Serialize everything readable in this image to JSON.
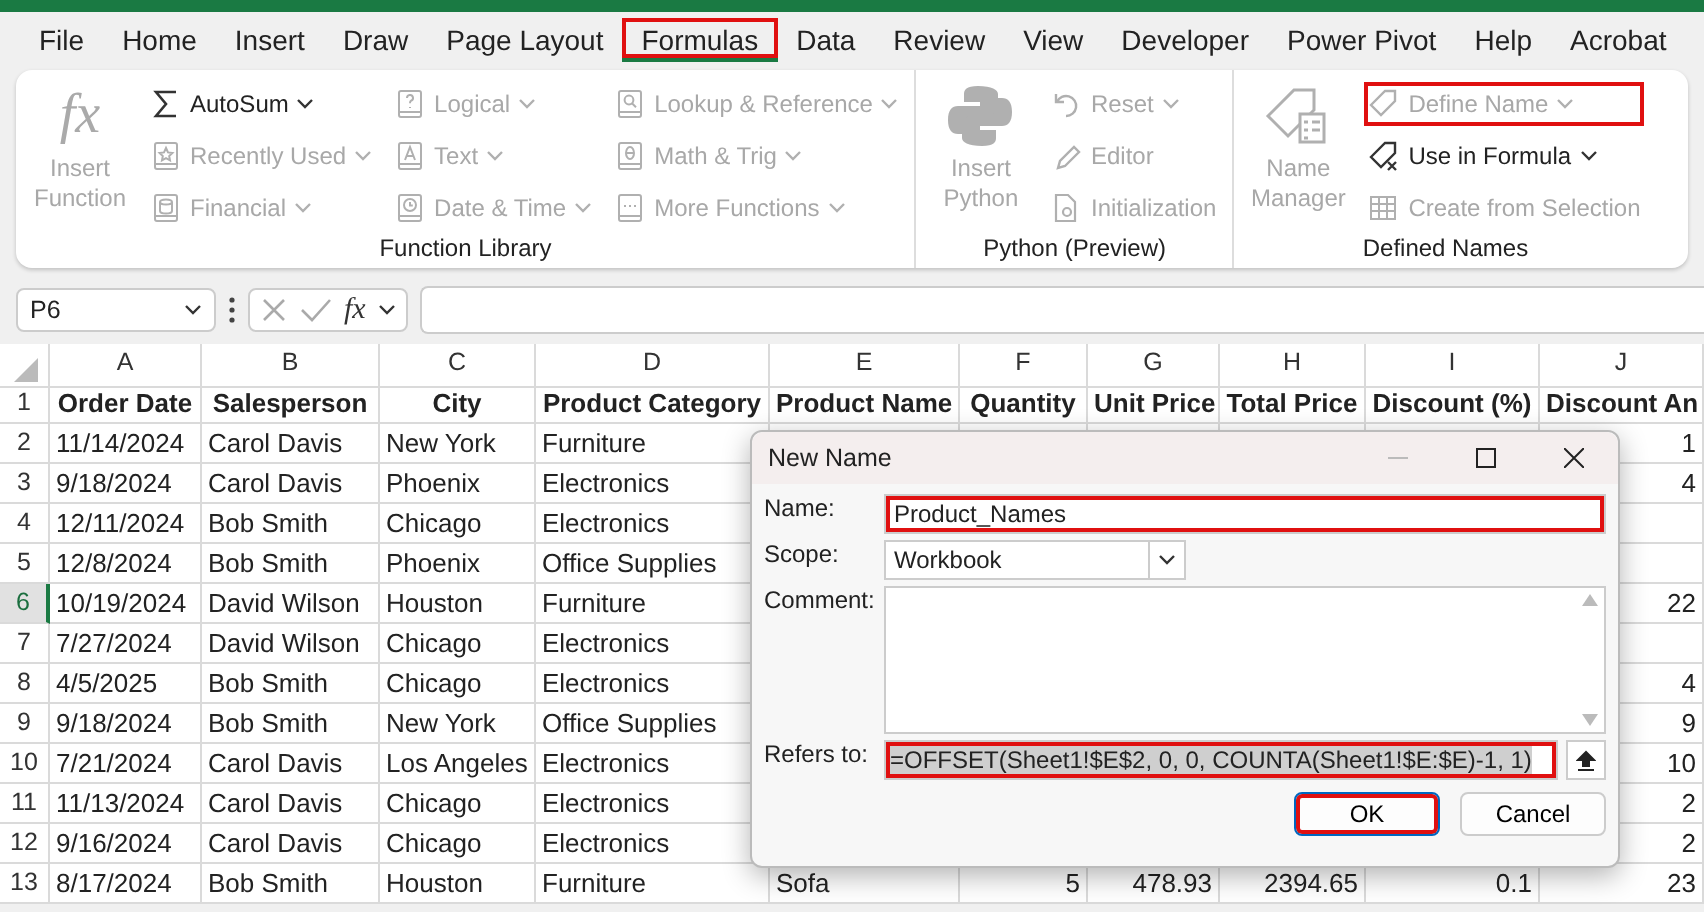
{
  "tabs": [
    {
      "label": "File",
      "selected": false,
      "highlighted": false
    },
    {
      "label": "Home",
      "selected": false,
      "highlighted": false
    },
    {
      "label": "Insert",
      "selected": false,
      "highlighted": false
    },
    {
      "label": "Draw",
      "selected": false,
      "highlighted": false
    },
    {
      "label": "Page Layout",
      "selected": false,
      "highlighted": false
    },
    {
      "label": "Formulas",
      "selected": true,
      "highlighted": true
    },
    {
      "label": "Data",
      "selected": false,
      "highlighted": false
    },
    {
      "label": "Review",
      "selected": false,
      "highlighted": false
    },
    {
      "label": "View",
      "selected": false,
      "highlighted": false
    },
    {
      "label": "Developer",
      "selected": false,
      "highlighted": false
    },
    {
      "label": "Power Pivot",
      "selected": false,
      "highlighted": false
    },
    {
      "label": "Help",
      "selected": false,
      "highlighted": false
    },
    {
      "label": "Acrobat",
      "selected": false,
      "highlighted": false
    }
  ],
  "ribbon": {
    "groups": [
      {
        "label": "Function Library",
        "items": [
          {
            "kind": "large",
            "label": "Insert Function",
            "icon_text": "fx",
            "disabled": true,
            "dropdown": false,
            "highlighted": false
          },
          {
            "kind": "small",
            "label": "AutoSum",
            "disabled": false,
            "dropdown": true,
            "highlighted": false
          },
          {
            "kind": "small",
            "label": "Recently Used",
            "disabled": true,
            "dropdown": true,
            "highlighted": false
          },
          {
            "kind": "small",
            "label": "Financial",
            "disabled": true,
            "dropdown": true,
            "highlighted": false
          },
          {
            "kind": "small",
            "label": "Logical",
            "disabled": true,
            "dropdown": true,
            "highlighted": false
          },
          {
            "kind": "small",
            "label": "Text",
            "disabled": true,
            "dropdown": true,
            "highlighted": false
          },
          {
            "kind": "small",
            "label": "Date & Time",
            "disabled": true,
            "dropdown": true,
            "highlighted": false
          },
          {
            "kind": "small",
            "label": "Lookup & Reference",
            "disabled": true,
            "dropdown": true,
            "highlighted": false
          },
          {
            "kind": "small",
            "label": "Math & Trig",
            "disabled": true,
            "dropdown": true,
            "highlighted": false
          },
          {
            "kind": "small",
            "label": "More Functions",
            "disabled": true,
            "dropdown": true,
            "highlighted": false
          }
        ]
      },
      {
        "label": "Python (Preview)",
        "items": [
          {
            "kind": "large",
            "label": "Insert Python",
            "disabled": true,
            "dropdown": false,
            "highlighted": false
          },
          {
            "kind": "small",
            "label": "Reset",
            "disabled": true,
            "dropdown": true,
            "highlighted": false
          },
          {
            "kind": "small",
            "label": "Editor",
            "disabled": true,
            "dropdown": false,
            "highlighted": false
          },
          {
            "kind": "small",
            "label": "Initialization",
            "disabled": true,
            "dropdown": false,
            "highlighted": false
          }
        ]
      },
      {
        "label": "Defined Names",
        "items": [
          {
            "kind": "large",
            "label": "Name Manager",
            "disabled": true,
            "dropdown": false,
            "highlighted": false
          },
          {
            "kind": "small",
            "label": "Define Name",
            "disabled": true,
            "dropdown": true,
            "highlighted": true
          },
          {
            "kind": "small",
            "label": "Use in Formula",
            "disabled": false,
            "dropdown": true,
            "highlighted": false
          },
          {
            "kind": "small",
            "label": "Create from Selection",
            "disabled": true,
            "dropdown": false,
            "highlighted": false
          }
        ]
      }
    ]
  },
  "formula_bar": {
    "name_box": "P6",
    "fx": "fx"
  },
  "sheet": {
    "columns": [
      "A",
      "B",
      "C",
      "D",
      "E",
      "F",
      "G",
      "H",
      "I",
      "J"
    ],
    "rows": [
      {
        "number": "1",
        "selected": false,
        "cells": [
          "Order Date",
          "Salesperson",
          "City",
          "Product Category",
          "Product Name",
          "Quantity",
          "Unit Price",
          "Total Price",
          "Discount (%)",
          "Discount An"
        ]
      },
      {
        "number": "2",
        "selected": false,
        "cells": [
          "11/14/2024",
          "Carol Davis",
          "New York",
          "Furniture",
          null,
          null,
          null,
          null,
          null,
          "1"
        ]
      },
      {
        "number": "3",
        "selected": false,
        "cells": [
          "9/18/2024",
          "Carol Davis",
          "Phoenix",
          "Electronics",
          null,
          null,
          null,
          null,
          null,
          "4"
        ]
      },
      {
        "number": "4",
        "selected": false,
        "cells": [
          "12/11/2024",
          "Bob Smith",
          "Chicago",
          "Electronics",
          null,
          null,
          null,
          null,
          null,
          null
        ]
      },
      {
        "number": "5",
        "selected": false,
        "cells": [
          "12/8/2024",
          "Bob Smith",
          "Phoenix",
          "Office Supplies",
          null,
          null,
          null,
          null,
          null,
          null
        ]
      },
      {
        "number": "6",
        "selected": true,
        "cells": [
          "10/19/2024",
          "David Wilson",
          "Houston",
          "Furniture",
          null,
          null,
          null,
          null,
          null,
          "22"
        ]
      },
      {
        "number": "7",
        "selected": false,
        "cells": [
          "7/27/2024",
          "David Wilson",
          "Chicago",
          "Electronics",
          null,
          null,
          null,
          null,
          null,
          null
        ]
      },
      {
        "number": "8",
        "selected": false,
        "cells": [
          "4/5/2025",
          "Bob Smith",
          "Chicago",
          "Electronics",
          null,
          null,
          null,
          null,
          null,
          "4"
        ]
      },
      {
        "number": "9",
        "selected": false,
        "cells": [
          "9/18/2024",
          "Bob Smith",
          "New York",
          "Office Supplies",
          null,
          null,
          null,
          null,
          null,
          "9"
        ]
      },
      {
        "number": "10",
        "selected": false,
        "cells": [
          "7/21/2024",
          "Carol Davis",
          "Los Angeles",
          "Electronics",
          null,
          null,
          null,
          null,
          null,
          "10"
        ]
      },
      {
        "number": "11",
        "selected": false,
        "cells": [
          "11/13/2024",
          "Carol Davis",
          "Chicago",
          "Electronics",
          null,
          null,
          null,
          null,
          null,
          "2"
        ]
      },
      {
        "number": "12",
        "selected": false,
        "cells": [
          "9/16/2024",
          "Carol Davis",
          "Chicago",
          "Electronics",
          null,
          null,
          null,
          null,
          null,
          "2"
        ]
      },
      {
        "number": "13",
        "selected": false,
        "cells": [
          "8/17/2024",
          "Bob Smith",
          "Houston",
          "Furniture",
          "Sofa",
          "5",
          "478.93",
          "2394.65",
          "0.1",
          "23"
        ]
      }
    ]
  },
  "dialog": {
    "title": "New Name",
    "fields": [
      {
        "kind": "text",
        "label": "Name:",
        "value": "Product_Names",
        "highlighted": true
      },
      {
        "kind": "select",
        "label": "Scope:",
        "value": "Workbook",
        "highlighted": false
      },
      {
        "kind": "textarea",
        "label": "Comment:",
        "highlighted": false
      },
      {
        "kind": "reference",
        "label": "Refers to:",
        "value": "=OFFSET(Sheet1!$E$2, 0, 0, COUNTA(Sheet1!$E:$E)-1, 1)",
        "text_selected": true,
        "highlighted": true
      }
    ],
    "buttons": [
      {
        "label": "OK",
        "default": true,
        "highlighted": true
      },
      {
        "label": "Cancel",
        "default": false,
        "highlighted": false
      }
    ]
  }
}
